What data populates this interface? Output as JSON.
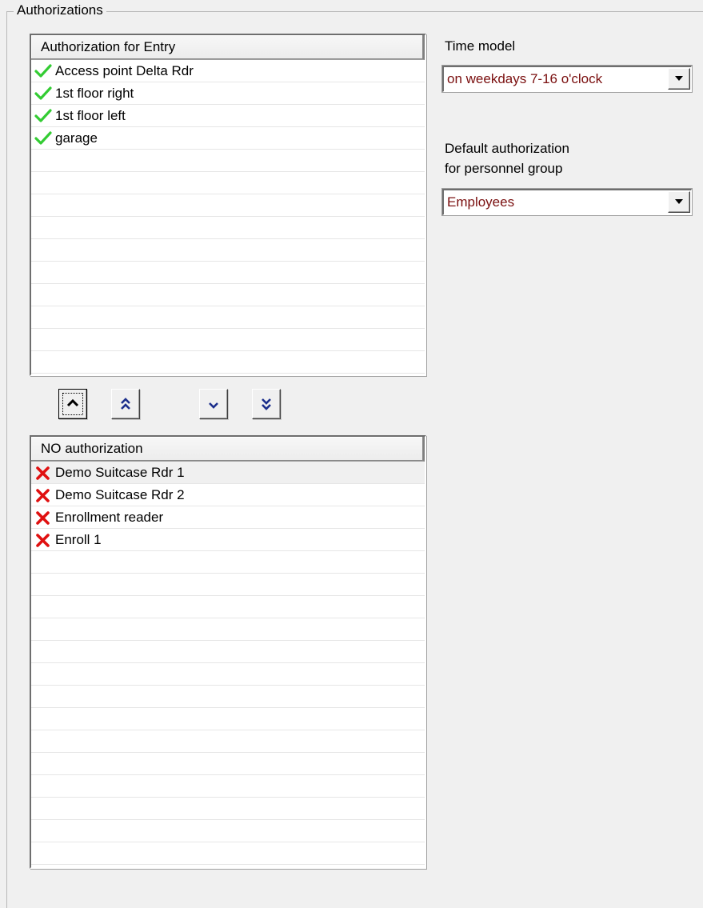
{
  "group": {
    "title": "Authorizations"
  },
  "authorized_list": {
    "header": "Authorization for Entry",
    "icon": "check-icon",
    "icon_color": "#33cc33",
    "items": [
      "Access point Delta Rdr",
      "1st floor right",
      "1st floor left",
      "garage"
    ]
  },
  "unauthorized_list": {
    "header": "NO authorization",
    "icon": "cross-icon",
    "icon_color": "#e01010",
    "items": [
      "Demo Suitcase Rdr 1",
      "Demo Suitcase Rdr 2",
      "Enrollment reader",
      "Enroll 1"
    ],
    "selected_index": 0
  },
  "time_model": {
    "label": "Time model",
    "value": "on weekdays 7-16 o'clock"
  },
  "default_group": {
    "label_line1": "Default authorization",
    "label_line2": "for personnel group",
    "value": "Employees"
  },
  "move_buttons": [
    {
      "name": "move-up-button",
      "icon": "chevron-up-icon"
    },
    {
      "name": "move-all-up-button",
      "icon": "double-chevron-up-icon"
    },
    {
      "name": "move-down-button",
      "icon": "chevron-down-icon"
    },
    {
      "name": "move-all-down-button",
      "icon": "double-chevron-down-icon"
    }
  ],
  "colors": {
    "dropdown_text": "#7a0f0f",
    "button_glyph": "#1c2f8c"
  }
}
